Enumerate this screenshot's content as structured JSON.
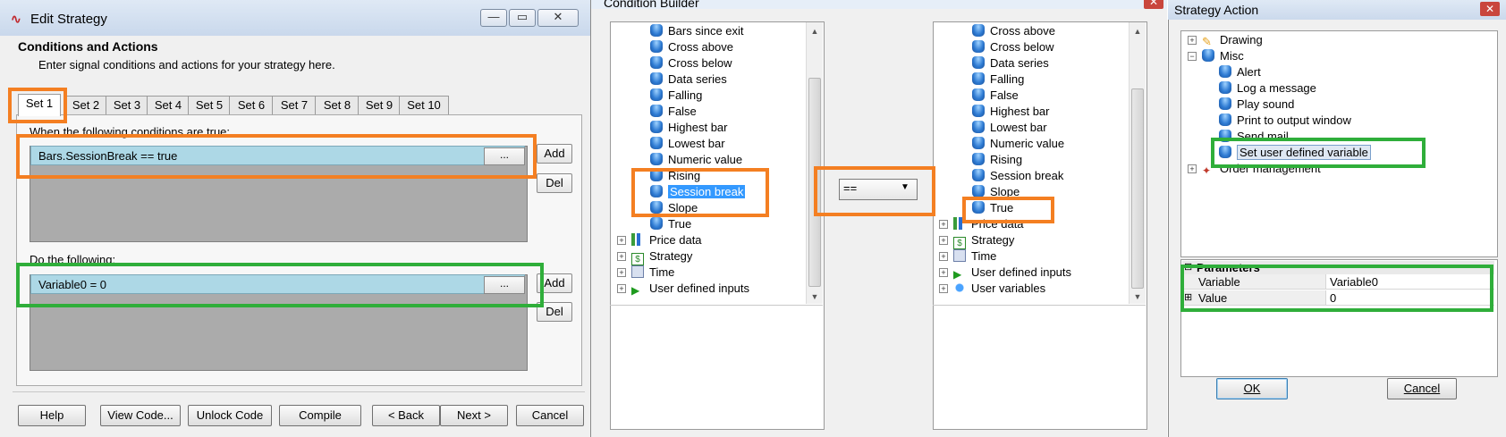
{
  "edit_strategy": {
    "title": "Edit Strategy",
    "section_title": "Conditions and Actions",
    "section_subtitle": "Enter signal conditions and actions for your strategy here.",
    "tabs": [
      "Set 1",
      "Set 2",
      "Set 3",
      "Set 4",
      "Set 5",
      "Set 6",
      "Set 7",
      "Set 8",
      "Set 9",
      "Set 10"
    ],
    "conditions_label": "When the following conditions are true:",
    "condition_row": "Bars.SessionBreak == true",
    "actions_label": "Do the following:",
    "action_row": "Variable0 = 0",
    "ellipsis": "...",
    "add_label": "Add",
    "del_label": "Del",
    "buttons": {
      "help": "Help",
      "view_code": "View Code...",
      "unlock_code": "Unlock Code",
      "compile": "Compile",
      "back": "< Back",
      "next": "Next >",
      "cancel": "Cancel"
    },
    "caption_min": "—",
    "caption_max": "▭",
    "caption_close": "✕"
  },
  "condition_builder": {
    "title": "Condition Builder",
    "left_items": [
      "Bars since exit",
      "Cross above",
      "Cross below",
      "Data series",
      "Falling",
      "False",
      "Highest bar",
      "Lowest bar",
      "Numeric value",
      "Rising",
      "Session break",
      "Slope",
      "True"
    ],
    "left_selected": "Session break",
    "left_groups": [
      "Price data",
      "Strategy",
      "Time",
      "User defined inputs"
    ],
    "operator": "==",
    "right_items": [
      "Cross above",
      "Cross below",
      "Data series",
      "Falling",
      "False",
      "Highest bar",
      "Lowest bar",
      "Numeric value",
      "Rising",
      "Session break",
      "Slope",
      "True"
    ],
    "right_groups": [
      "Price data",
      "Strategy",
      "Time",
      "User defined inputs",
      "User variables"
    ]
  },
  "strategy_action": {
    "title": "Strategy Action",
    "tree": {
      "drawing": "Drawing",
      "misc": "Misc",
      "misc_children": [
        "Alert",
        "Log a message",
        "Play sound",
        "Print to output window",
        "Send mail",
        "Set user defined variable"
      ],
      "order_management": "Order management"
    },
    "params_title": "Parameters",
    "params": [
      {
        "name": "Variable",
        "value": "Variable0"
      },
      {
        "name": "Value",
        "value": "0"
      }
    ],
    "ok": "OK",
    "cancel": "Cancel"
  },
  "colors": {
    "highlight_orange": "#f47f22",
    "highlight_green": "#2fae3a",
    "selected_row": "#add8e6",
    "selection_blue": "#3399ff"
  }
}
